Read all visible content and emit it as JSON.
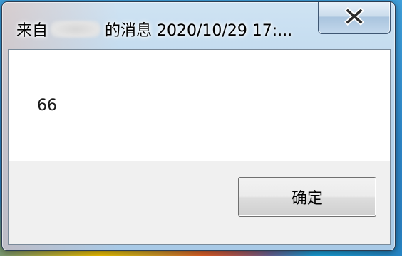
{
  "dialog": {
    "title_prefix": "来自",
    "title_suffix": "的消息 2020/10/29 17:...",
    "message": "66",
    "ok_label": "确定"
  },
  "icons": {
    "close": "close-icon"
  },
  "colors": {
    "title_bar": "#b9d5ec",
    "content_bg": "#ffffff",
    "button_area_bg": "#f0f0f0",
    "frame_border": "#2b3d52"
  }
}
